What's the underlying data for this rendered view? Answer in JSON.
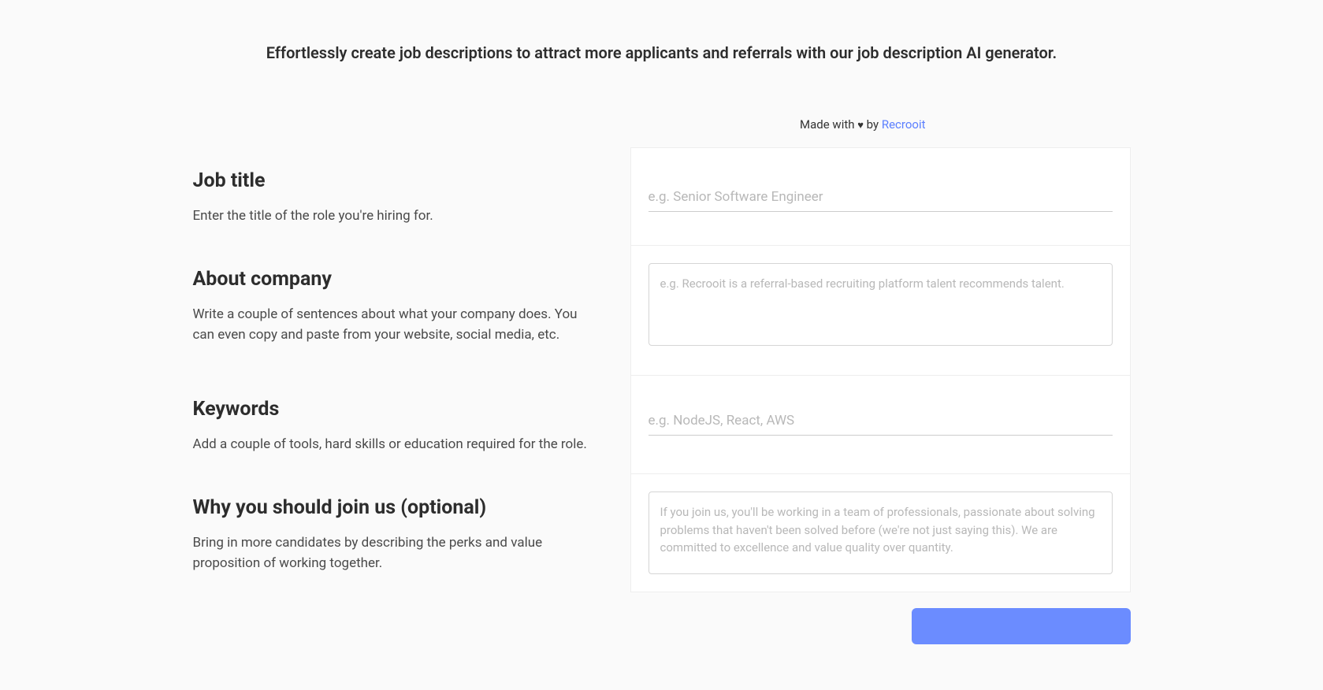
{
  "subtitle": "Effortlessly create job descriptions to attract more applicants and referrals with our job description AI generator.",
  "attribution": {
    "prefix": "Made with ",
    "heart": "♥",
    "by": " by ",
    "link_text": "Recrooit"
  },
  "form": {
    "job_title": {
      "heading": "Job title",
      "description": "Enter the title of the role you're hiring for.",
      "placeholder": "e.g. Senior Software Engineer"
    },
    "about_company": {
      "heading": "About company",
      "description": "Write a couple of sentences about what your company does. You can even copy and paste from your website, social media, etc.",
      "placeholder": "e.g. Recrooit is a referral-based recruiting platform talent recommends talent."
    },
    "keywords": {
      "heading": "Keywords",
      "description": "Add a couple of tools, hard skills or education required for the role.",
      "placeholder": "e.g. NodeJS, React, AWS"
    },
    "why_join": {
      "heading": "Why you should join us (optional)",
      "description": "Bring in more candidates by describing the perks and value proposition of working together.",
      "placeholder": "If you join us, you'll be working in a team of professionals, passionate about solving problems that haven't been solved before (we're not just saying this). We are committed to excellence and value quality over quantity."
    }
  }
}
